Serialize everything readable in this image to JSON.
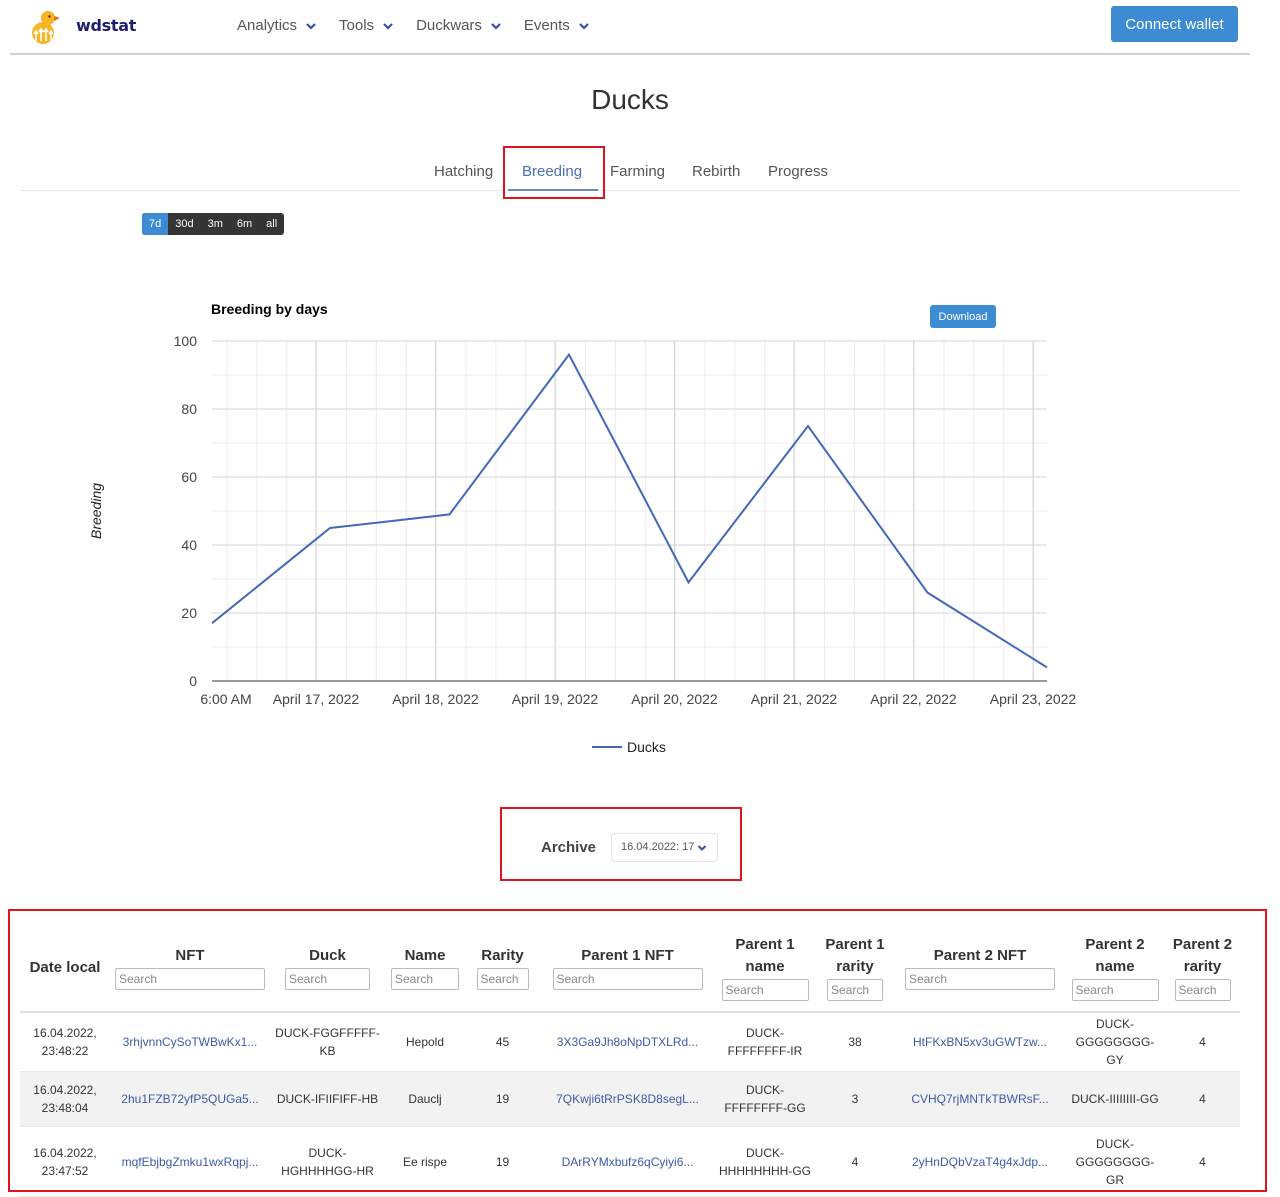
{
  "header": {
    "brand": "wdstat",
    "menu": [
      {
        "label": "Analytics"
      },
      {
        "label": "Tools"
      },
      {
        "label": "Duckwars"
      },
      {
        "label": "Events"
      }
    ],
    "connect_label": "Connect wallet"
  },
  "page": {
    "title": "Ducks",
    "tabs": [
      {
        "label": "Hatching",
        "active": false
      },
      {
        "label": "Breeding",
        "active": true
      },
      {
        "label": "Farming",
        "active": false
      },
      {
        "label": "Rebirth",
        "active": false
      },
      {
        "label": "Progress",
        "active": false
      }
    ],
    "ranges": [
      {
        "label": "7d",
        "active": true
      },
      {
        "label": "30d",
        "active": false
      },
      {
        "label": "3m",
        "active": false
      },
      {
        "label": "6m",
        "active": false
      },
      {
        "label": "all",
        "active": false
      }
    ]
  },
  "colors": {
    "accent": "#3d8bd3",
    "series": "#4169b8",
    "highlight": "#e0141e",
    "link": "#3c5aa8"
  },
  "download_label": "Download",
  "chart_data": {
    "type": "line",
    "title": "Breeding by days",
    "xlabel": "",
    "ylabel": "Breeding",
    "ylim": [
      0,
      100
    ],
    "yticks": [
      0,
      20,
      40,
      60,
      80,
      100
    ],
    "grid": true,
    "legend": "bottom",
    "x": [
      "2022-04-16",
      "2022-04-17",
      "2022-04-18",
      "2022-04-19",
      "2022-04-20",
      "2022-04-21",
      "2022-04-22",
      "2022-04-23"
    ],
    "xtick_labels": [
      "6:00 AM",
      "April 17, 2022",
      "April 18, 2022",
      "April 19, 2022",
      "April 20, 2022",
      "April 21, 2022",
      "April 22, 2022",
      "April 23, 2022"
    ],
    "series": [
      {
        "name": "Ducks",
        "values": [
          17,
          45,
          49,
          96,
          29,
          75,
          26,
          4
        ]
      }
    ]
  },
  "archive": {
    "label": "Archive",
    "selected": "16.04.2022: 17"
  },
  "table": {
    "columns": [
      {
        "label": "Date local",
        "search": false
      },
      {
        "label": "NFT",
        "search": true
      },
      {
        "label": "Duck",
        "search": true
      },
      {
        "label": "Name",
        "search": true
      },
      {
        "label": "Rarity",
        "search": true
      },
      {
        "label": "Parent 1 NFT",
        "search": true
      },
      {
        "label": "Parent 1 name",
        "search": true
      },
      {
        "label": "Parent 1 rarity",
        "search": true
      },
      {
        "label": "Parent 2 NFT",
        "search": true
      },
      {
        "label": "Parent 2 name",
        "search": true
      },
      {
        "label": "Parent 2 rarity",
        "search": true
      }
    ],
    "search_placeholder": "Search",
    "rows": [
      {
        "date": "16.04.2022, 23:48:22",
        "nft": "3rhjvnnCySoTWBwKx1...",
        "duck": "DUCK-FGGFFFFF-KB",
        "name": "Hepold",
        "rarity": "45",
        "p1_nft": "3X3Ga9Jh8oNpDTXLRd...",
        "p1_name": "DUCK-FFFFFFFF-IR",
        "p1_rarity": "38",
        "p2_nft": "HtFKxBN5xv3uGWTzw...",
        "p2_name": "DUCK-GGGGGGGG-GY",
        "p2_rarity": "4"
      },
      {
        "date": "16.04.2022, 23:48:04",
        "nft": "2hu1FZB72yfP5QUGa5...",
        "duck": "DUCK-IFIIFIFF-HB",
        "name": "Dauclj",
        "rarity": "19",
        "p1_nft": "7QKwji6tRrPSK8D8segL...",
        "p1_name": "DUCK-FFFFFFFF-GG",
        "p1_rarity": "3",
        "p2_nft": "CVHQ7rjMNTkTBWRsF...",
        "p2_name": "DUCK-IIIIIIII-GG",
        "p2_rarity": "4"
      },
      {
        "date": "16.04.2022, 23:47:52",
        "nft": "mqfEbjbgZmku1wxRqpj...",
        "duck": "DUCK-HGHHHHGG-HR",
        "name": "Ee rispe",
        "rarity": "19",
        "p1_nft": "DArRYMxbufz6qCyiyi6...",
        "p1_name": "DUCK-HHHHHHHH-GG",
        "p1_rarity": "4",
        "p2_nft": "2yHnDQbVzaT4g4xJdp...",
        "p2_name": "DUCK-GGGGGGGG-GR",
        "p2_rarity": "4"
      }
    ]
  }
}
